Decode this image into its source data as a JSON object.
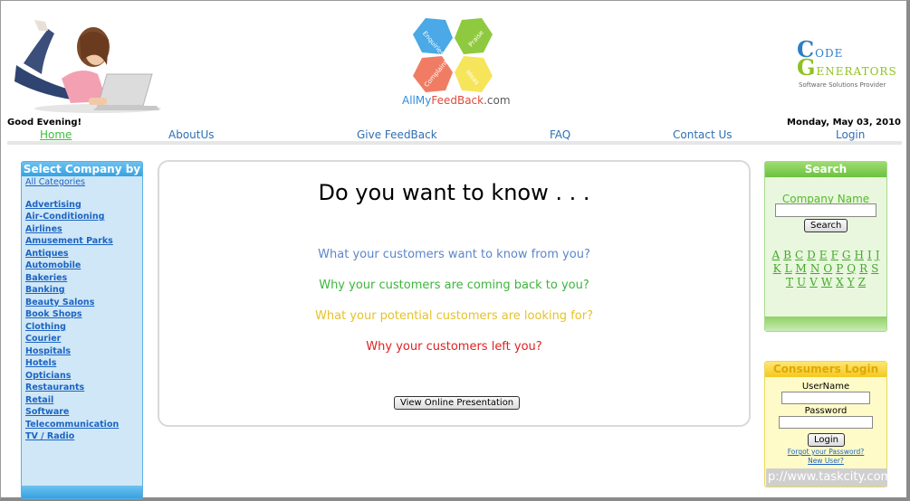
{
  "header": {
    "logo_name": "AllMyFeedBack.com",
    "logo_parts": {
      "allmy": "AllMy",
      "feed": "FeedBack",
      "dotcom": ".com"
    },
    "petals": [
      "Enquiries",
      "Praise",
      "Complaints",
      "Ideas"
    ],
    "sponsor": {
      "line1_big": "C",
      "line1": "ODE",
      "line2_big": "G",
      "line2": "ENERATORS",
      "line3": "Software Solutions Provider"
    },
    "greeting": "Good Evening!",
    "date": "Monday, May 03, 2010"
  },
  "nav": {
    "home": "Home",
    "about": "AboutUs",
    "feedback": "Give FeedBack",
    "faq": "FAQ",
    "contact": "Contact Us",
    "login": "Login"
  },
  "left": {
    "title": "Select Company by",
    "all": "All Categories",
    "categories": [
      "Advertising",
      "Air-Conditioning",
      "Airlines",
      "Amusement Parks",
      "Antiques",
      "Automobile",
      "Bakeries",
      "Banking",
      "Beauty Salons",
      "Book Shops",
      "Clothing",
      "Courier",
      "Hospitals",
      "Hotels",
      "Opticians",
      "Restaurants",
      "Retail",
      "Software",
      "Telecommunication",
      "TV / Radio"
    ]
  },
  "center": {
    "headline": "Do you want to know . . .",
    "q1": "What your customers want to know from you?",
    "q2": "Why your customers are coming back to you?",
    "q3": "What your potential customers are looking for?",
    "q4": "Why your customers left you?",
    "button": "View Online Presentation"
  },
  "search": {
    "title": "Search",
    "label": "Company Name",
    "button": "Search",
    "row1": [
      "A",
      "B",
      "C",
      "D",
      "E",
      "F",
      "G",
      "H",
      "I",
      "J"
    ],
    "row2": [
      "K",
      "L",
      "M",
      "N",
      "O",
      "P",
      "Q",
      "R",
      "S"
    ],
    "row3": [
      "T",
      "U",
      "V",
      "W",
      "X",
      "Y",
      "Z"
    ]
  },
  "login": {
    "title": "Consumers Login",
    "username_label": "UserName",
    "password_label": "Password",
    "button": "Login",
    "forgot": "Forgot your Password?",
    "newuser": "New User?"
  },
  "watermark": "p://www.taskcity.com",
  "colors": {
    "q1": "#5b86c9",
    "q2": "#3cb53c",
    "q3": "#e6c22a",
    "q4": "#e02020",
    "nav": "#2f6fb5",
    "nav_active": "#3bbf3b"
  }
}
